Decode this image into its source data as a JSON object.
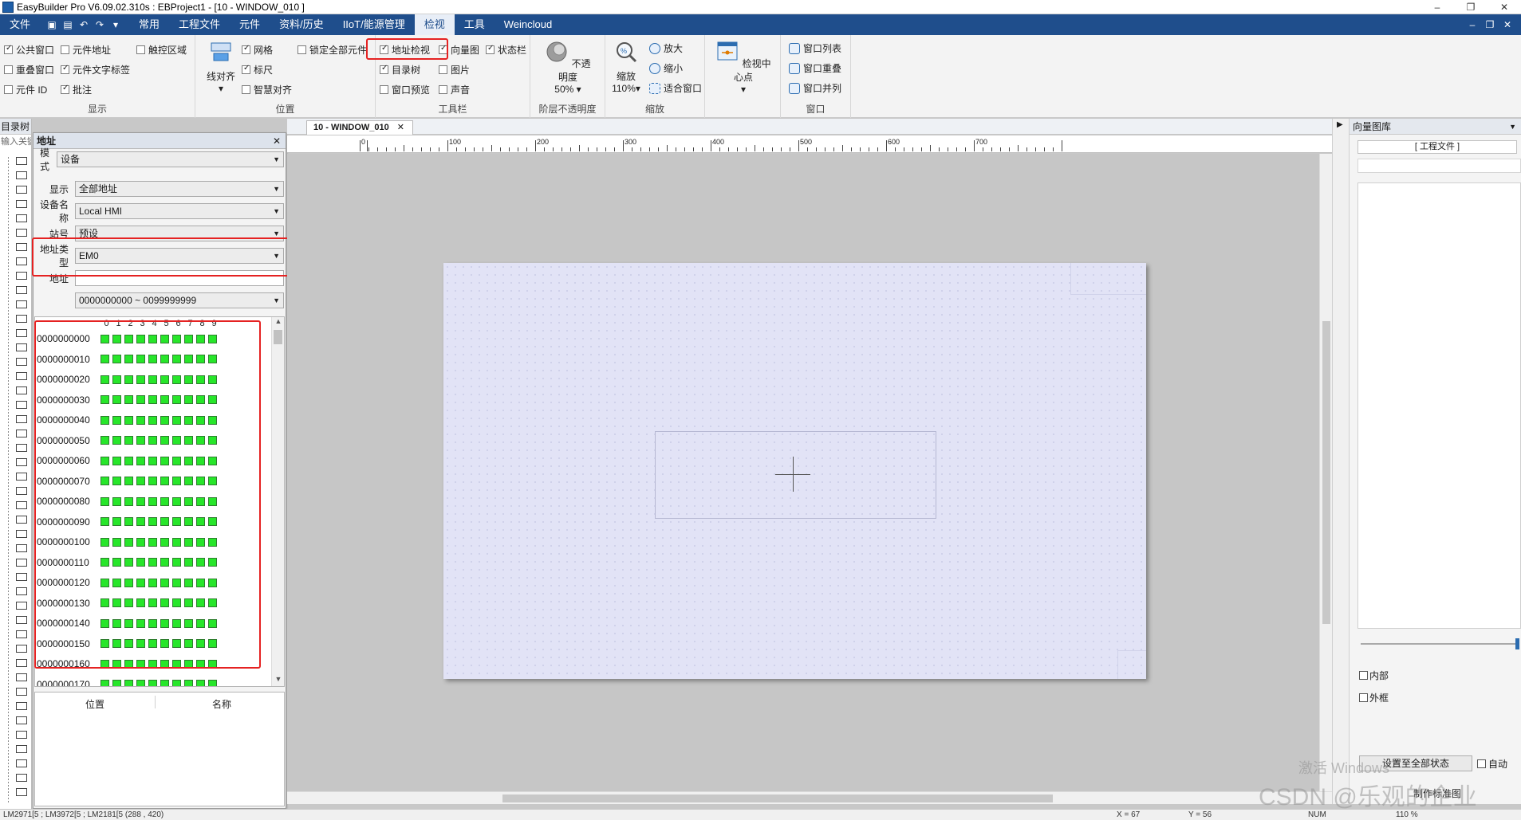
{
  "app": {
    "title": "EasyBuilder Pro V6.09.02.310s : EBProject1 - [10 - WINDOW_010 ]",
    "win_minimize": "–",
    "win_restore": "❐",
    "win_close": "✕"
  },
  "menu": {
    "items": [
      "文件",
      "常用",
      "工程文件",
      "元件",
      "资料/历史",
      "IIoT/能源管理",
      "检视",
      "工具",
      "Weincloud"
    ],
    "active_index": 6
  },
  "ribbon": {
    "display": {
      "label": "显示",
      "checks": [
        {
          "label": "公共窗口",
          "checked": true
        },
        {
          "label": "元件地址",
          "checked": false
        },
        {
          "label": "触控区域",
          "checked": false
        },
        {
          "label": "重叠窗口",
          "checked": false
        },
        {
          "label": "元件文字标签",
          "checked": true
        },
        {
          "label": "元件 ID",
          "checked": false
        },
        {
          "label": "批注",
          "checked": true
        }
      ]
    },
    "position": {
      "label": "位置",
      "align_label": "线对齐",
      "checks": [
        {
          "label": "网格",
          "checked": true
        },
        {
          "label": "锁定全部元件",
          "checked": false
        },
        {
          "label": "标尺",
          "checked": true
        },
        {
          "label": "智慧对齐",
          "checked": false
        }
      ]
    },
    "toolbar": {
      "label": "工具栏",
      "checks": [
        {
          "label": "地址检视",
          "checked": true
        },
        {
          "label": "向量图",
          "checked": true
        },
        {
          "label": "状态栏",
          "checked": true
        },
        {
          "label": "目录树",
          "checked": true
        },
        {
          "label": "图片",
          "checked": false
        },
        {
          "label": "窗口预览",
          "checked": false
        },
        {
          "label": "声音",
          "checked": false
        }
      ]
    },
    "opacity": {
      "label": "阶层不透明度",
      "btn_label": "不透明度",
      "value": "50%"
    },
    "zoom": {
      "label": "缩放",
      "btn_label": "缩放",
      "value": "110%",
      "zoom_in": "放大",
      "zoom_out": "缩小",
      "fit": "适合窗口"
    },
    "view_center": {
      "label": "检视中心点"
    },
    "window": {
      "label": "窗口",
      "list": "窗口列表",
      "overlap": "窗口重叠",
      "tile": "窗口并列"
    }
  },
  "tree": {
    "title": "目录树",
    "search_placeholder": "输入关键"
  },
  "address": {
    "title": "地址",
    "close": "✕",
    "mode_label": "模式",
    "mode_value": "设备",
    "display_label": "显示",
    "display_value": "全部地址",
    "device_label": "设备名称",
    "device_value": "Local HMI",
    "station_label": "站号",
    "station_value": "预设",
    "type_label": "地址类型",
    "type_value": "EM0",
    "addr_label": "地址",
    "addr_value": "",
    "range_value": "0000000000 ~ 0099999999",
    "col_headers": [
      "0",
      "1",
      "2",
      "3",
      "4",
      "5",
      "6",
      "7",
      "8",
      "9"
    ],
    "rows": [
      "0000000000",
      "0000000010",
      "0000000020",
      "0000000030",
      "0000000040",
      "0000000050",
      "0000000060",
      "0000000070",
      "0000000080",
      "0000000090",
      "0000000100",
      "0000000110",
      "0000000120",
      "0000000130",
      "0000000140",
      "0000000150",
      "0000000160",
      "0000000170"
    ],
    "list_col_pos": "位置",
    "list_col_name": "名称"
  },
  "editor": {
    "tab_label": "10 - WINDOW_010",
    "tab_close": "✕",
    "ruler_labels": [
      "0",
      "100",
      "200",
      "300",
      "400",
      "500",
      "600",
      "700"
    ]
  },
  "right": {
    "title": "向量图库",
    "project_file": "[ 工程文件 ]",
    "inner": "内部",
    "frame": "外框",
    "set_all": "设置至全部状态",
    "auto": "自动",
    "bottom_tab": "制作标准图"
  },
  "status": {
    "left": "LM2971[5 ; LM3972[5 ; LM2181[5 (288 , 420)",
    "x": "X = 67",
    "y": "Y = 56",
    "num": "NUM",
    "zoom": "110 %"
  },
  "watermark": {
    "text": "CSDN @乐观的企业",
    "activate": "激活 Windows"
  }
}
